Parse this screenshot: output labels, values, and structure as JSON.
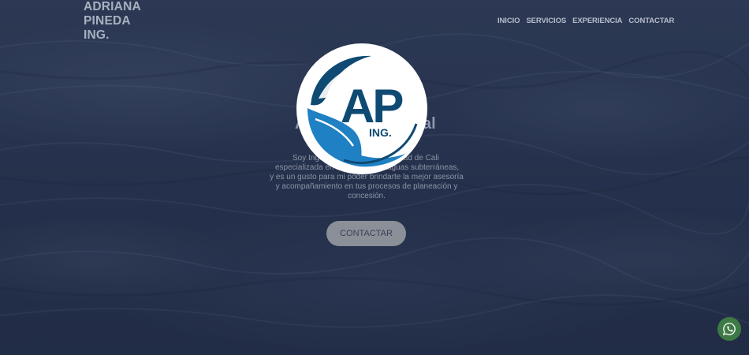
{
  "brand": {
    "line1": "ADRIANA",
    "line2": "PINEDA",
    "line3": "ING."
  },
  "nav": {
    "items": [
      {
        "label": "INICIO"
      },
      {
        "label": "SERVICIOS"
      },
      {
        "label": "EXPERIENCIA"
      },
      {
        "label": "CONTACTAR"
      }
    ]
  },
  "hero": {
    "title_left": "A",
    "title_right": "al",
    "text_line1_left": "Soy Inge",
    "text_line1_right": "idad de Cali",
    "text_line2_left": "especializada en",
    "text_line2_right": "aguas subterráneas,",
    "text_line3": "y es un gusto para mi poder brindarte la mejor asesoría",
    "text_line4": "y acompañamiento en tus procesos de planeación y",
    "text_line5": "concesión.",
    "cta_label": "CONTACTAR"
  },
  "logo": {
    "initials": "AP",
    "suffix": "ING.",
    "colors": {
      "dark_blue": "#0f4a73",
      "light_blue": "#1f80c4"
    }
  },
  "floating": {
    "whatsapp_icon": "whatsapp-icon",
    "color": "#3e7a45"
  }
}
